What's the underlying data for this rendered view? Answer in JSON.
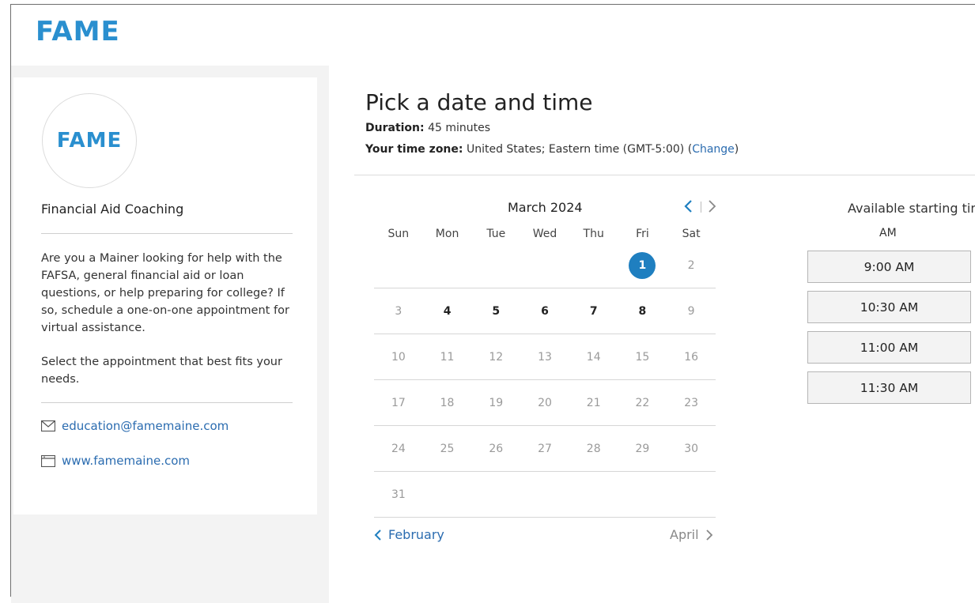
{
  "brand": {
    "logo_text": "FAME",
    "accent": "#2a8fcf"
  },
  "sidebar": {
    "service_name": "Financial Aid Coaching",
    "description": "Are you a Mainer looking for help with the FAFSA, general financial aid or loan questions, or help preparing for college? If so, schedule a one-on-one appointment for virtual assistance.",
    "instruction": "Select the appointment that best fits your needs.",
    "email": "education@famemaine.com",
    "website": "www.famemaine.com"
  },
  "main": {
    "title": "Pick a date and time",
    "duration_label": "Duration:",
    "duration_value": "45 minutes",
    "timezone_label": "Your time zone:",
    "timezone_value": "United States;  Eastern time  (GMT-5:00)",
    "timezone_change_open": "(",
    "timezone_change_link": "Change",
    "timezone_change_close": ")"
  },
  "calendar": {
    "month_title": "March 2024",
    "weekdays": [
      "Sun",
      "Mon",
      "Tue",
      "Wed",
      "Thu",
      "Fri",
      "Sat"
    ],
    "weeks": [
      [
        null,
        null,
        null,
        null,
        null,
        1,
        2
      ],
      [
        3,
        4,
        5,
        6,
        7,
        8,
        9
      ],
      [
        10,
        11,
        12,
        13,
        14,
        15,
        16
      ],
      [
        17,
        18,
        19,
        20,
        21,
        22,
        23
      ],
      [
        24,
        25,
        26,
        27,
        28,
        29,
        30
      ],
      [
        31,
        null,
        null,
        null,
        null,
        null,
        null
      ]
    ],
    "available_days": [
      1,
      4,
      5,
      6,
      7,
      8
    ],
    "selected_day": 1,
    "prev_month": "February",
    "next_month": "April",
    "selected_color": "#1f7fc0"
  },
  "times": {
    "title": "Available starting times",
    "period": "AM",
    "slots": [
      "9:00 AM",
      "10:30 AM",
      "11:00 AM",
      "11:30 AM"
    ]
  }
}
